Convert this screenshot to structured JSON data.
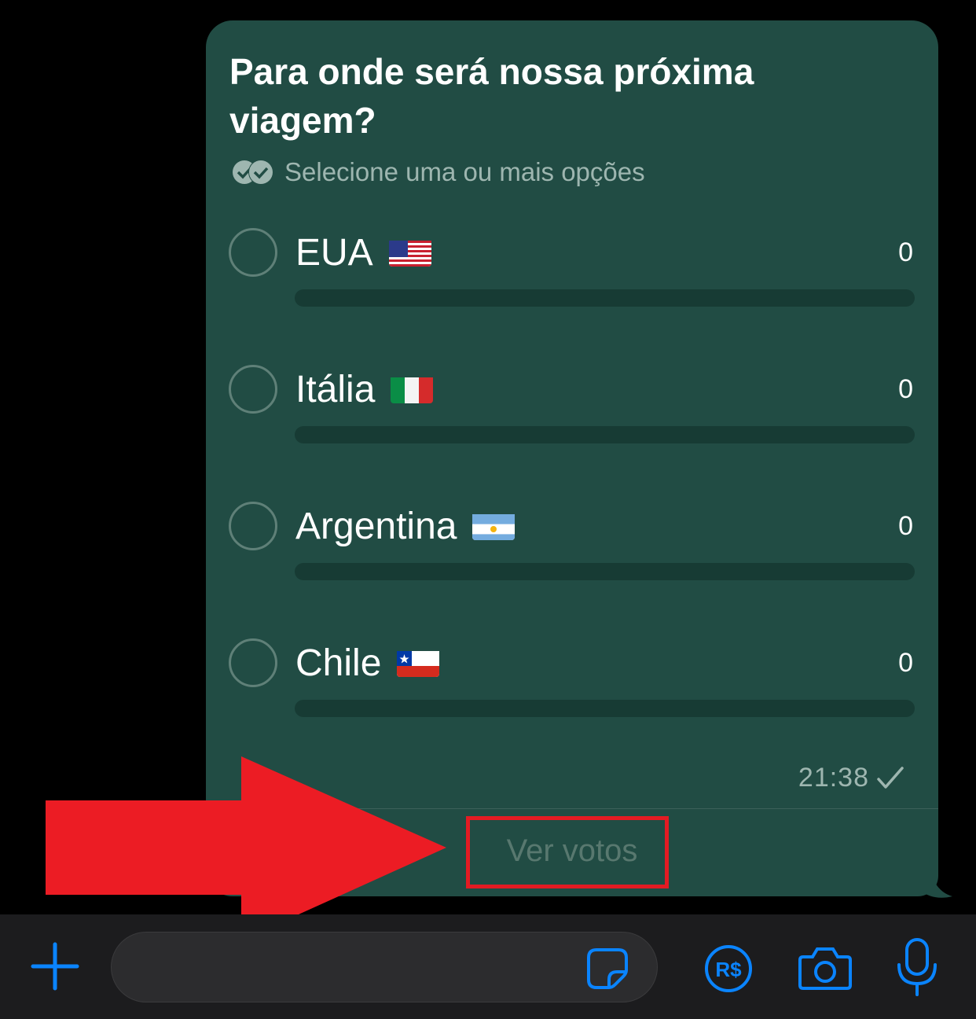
{
  "poll": {
    "question": "Para onde será nossa próxima viagem?",
    "subtitle": "Selecione uma ou mais opções",
    "options": [
      {
        "label": "EUA",
        "flag": "us-flag",
        "votes": "0",
        "fraction": 0
      },
      {
        "label": "Itália",
        "flag": "italy-flag",
        "votes": "0",
        "fraction": 0
      },
      {
        "label": "Argentina",
        "flag": "argentina-flag",
        "votes": "0",
        "fraction": 0
      },
      {
        "label": "Chile",
        "flag": "chile-flag",
        "votes": "0",
        "fraction": 0
      }
    ],
    "time": "21:38",
    "status_icon": "single-check-icon",
    "view_votes_label": "Ver votos"
  },
  "input_bar": {
    "icons": [
      "plus-icon",
      "sticker-icon",
      "pix-rs-icon",
      "camera-icon",
      "microphone-icon"
    ],
    "pix_label": "R$"
  },
  "colors": {
    "bubble": "#214c44",
    "accent": "#0a84ff",
    "annotation": "#e31b23",
    "muted_text": "#9eb6b0"
  }
}
